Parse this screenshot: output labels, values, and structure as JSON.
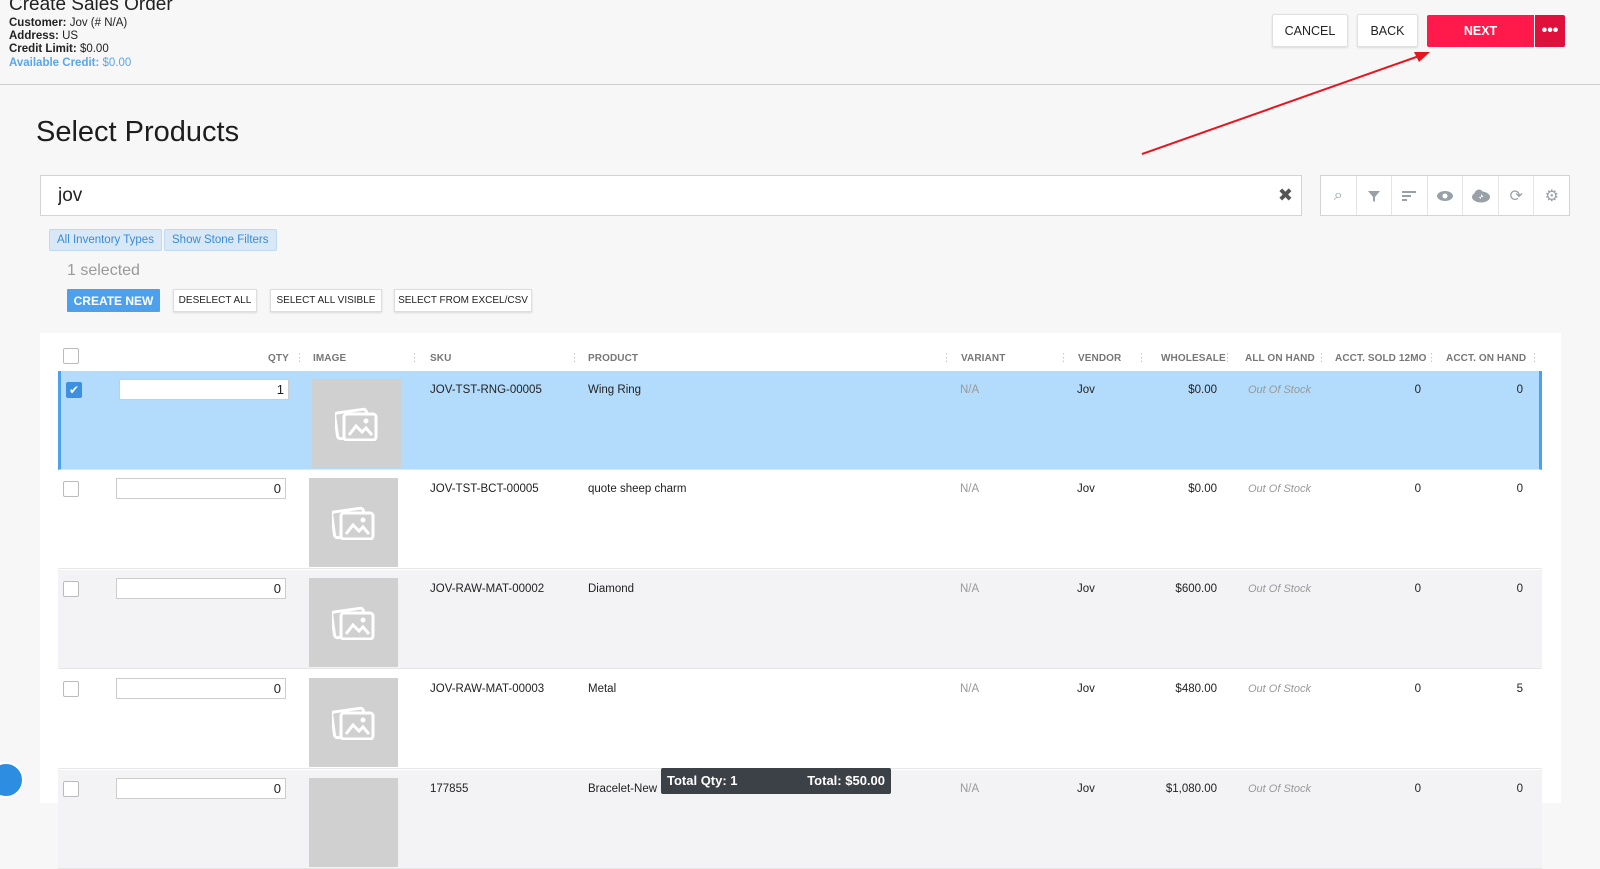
{
  "header": {
    "title": "Create Sales Order",
    "customer_label": "Customer:",
    "customer_value": "Jov (# N/A)",
    "address_label": "Address:",
    "address_value": "US",
    "credit_label": "Credit Limit:",
    "credit_value": "$0.00",
    "available_label": "Available Credit:",
    "available_value": "$0.00",
    "cancel": "CANCEL",
    "back": "BACK",
    "next": "NEXT",
    "more": "•••"
  },
  "section_title": "Select Products",
  "search": {
    "value": "jov"
  },
  "toolbar_icons": [
    "search-settings-icon",
    "filter-icon",
    "sort-icon",
    "eye-icon",
    "cloud-download-icon",
    "refresh-icon",
    "gear-icon"
  ],
  "chips": {
    "inventory": "All Inventory Types",
    "stone": "Show Stone Filters"
  },
  "selection": {
    "count": "1 selected",
    "create_new": "CREATE NEW",
    "deselect_all": "DESELECT ALL",
    "select_all_visible": "SELECT ALL VISIBLE",
    "select_excel": "SELECT FROM EXCEL/CSV"
  },
  "columns": {
    "qty": "QTY",
    "image": "IMAGE",
    "sku": "SKU",
    "product": "PRODUCT",
    "variant": "VARIANT",
    "vendor": "VENDOR",
    "wholesale": "WHOLESALE",
    "all_on_hand": "ALL ON HAND",
    "sold_12mo": "ACCT. SOLD 12MO",
    "acct_on_hand": "ACCT. ON HAND"
  },
  "rows": [
    {
      "qty": "1",
      "sku": "JOV-TST-RNG-00005",
      "product": "Wing Ring",
      "variant": "N/A",
      "vendor": "Jov",
      "wholesale": "$0.00",
      "stock": "Out Of Stock",
      "sold": "0",
      "onhand": "0"
    },
    {
      "qty": "0",
      "sku": "JOV-TST-BCT-00005",
      "product": "quote sheep charm",
      "variant": "N/A",
      "vendor": "Jov",
      "wholesale": "$0.00",
      "stock": "Out Of Stock",
      "sold": "0",
      "onhand": "0"
    },
    {
      "qty": "0",
      "sku": "JOV-RAW-MAT-00002",
      "product": "Diamond",
      "variant": "N/A",
      "vendor": "Jov",
      "wholesale": "$600.00",
      "stock": "Out Of Stock",
      "sold": "0",
      "onhand": "0"
    },
    {
      "qty": "0",
      "sku": "JOV-RAW-MAT-00003",
      "product": "Metal",
      "variant": "N/A",
      "vendor": "Jov",
      "wholesale": "$480.00",
      "stock": "Out Of Stock",
      "sold": "0",
      "onhand": "5"
    },
    {
      "qty": "0",
      "sku": "177855",
      "product": "Bracelet-New",
      "variant": "N/A",
      "vendor": "Jov",
      "wholesale": "$1,080.00",
      "stock": "Out Of Stock",
      "sold": "0",
      "onhand": "0"
    }
  ],
  "totals": {
    "qty": "Total Qty: 1",
    "total": "Total: $50.00"
  },
  "colors": {
    "next": "#ff1a4b",
    "accent": "#4da1ec",
    "selected_row": "#b3dcfc"
  }
}
